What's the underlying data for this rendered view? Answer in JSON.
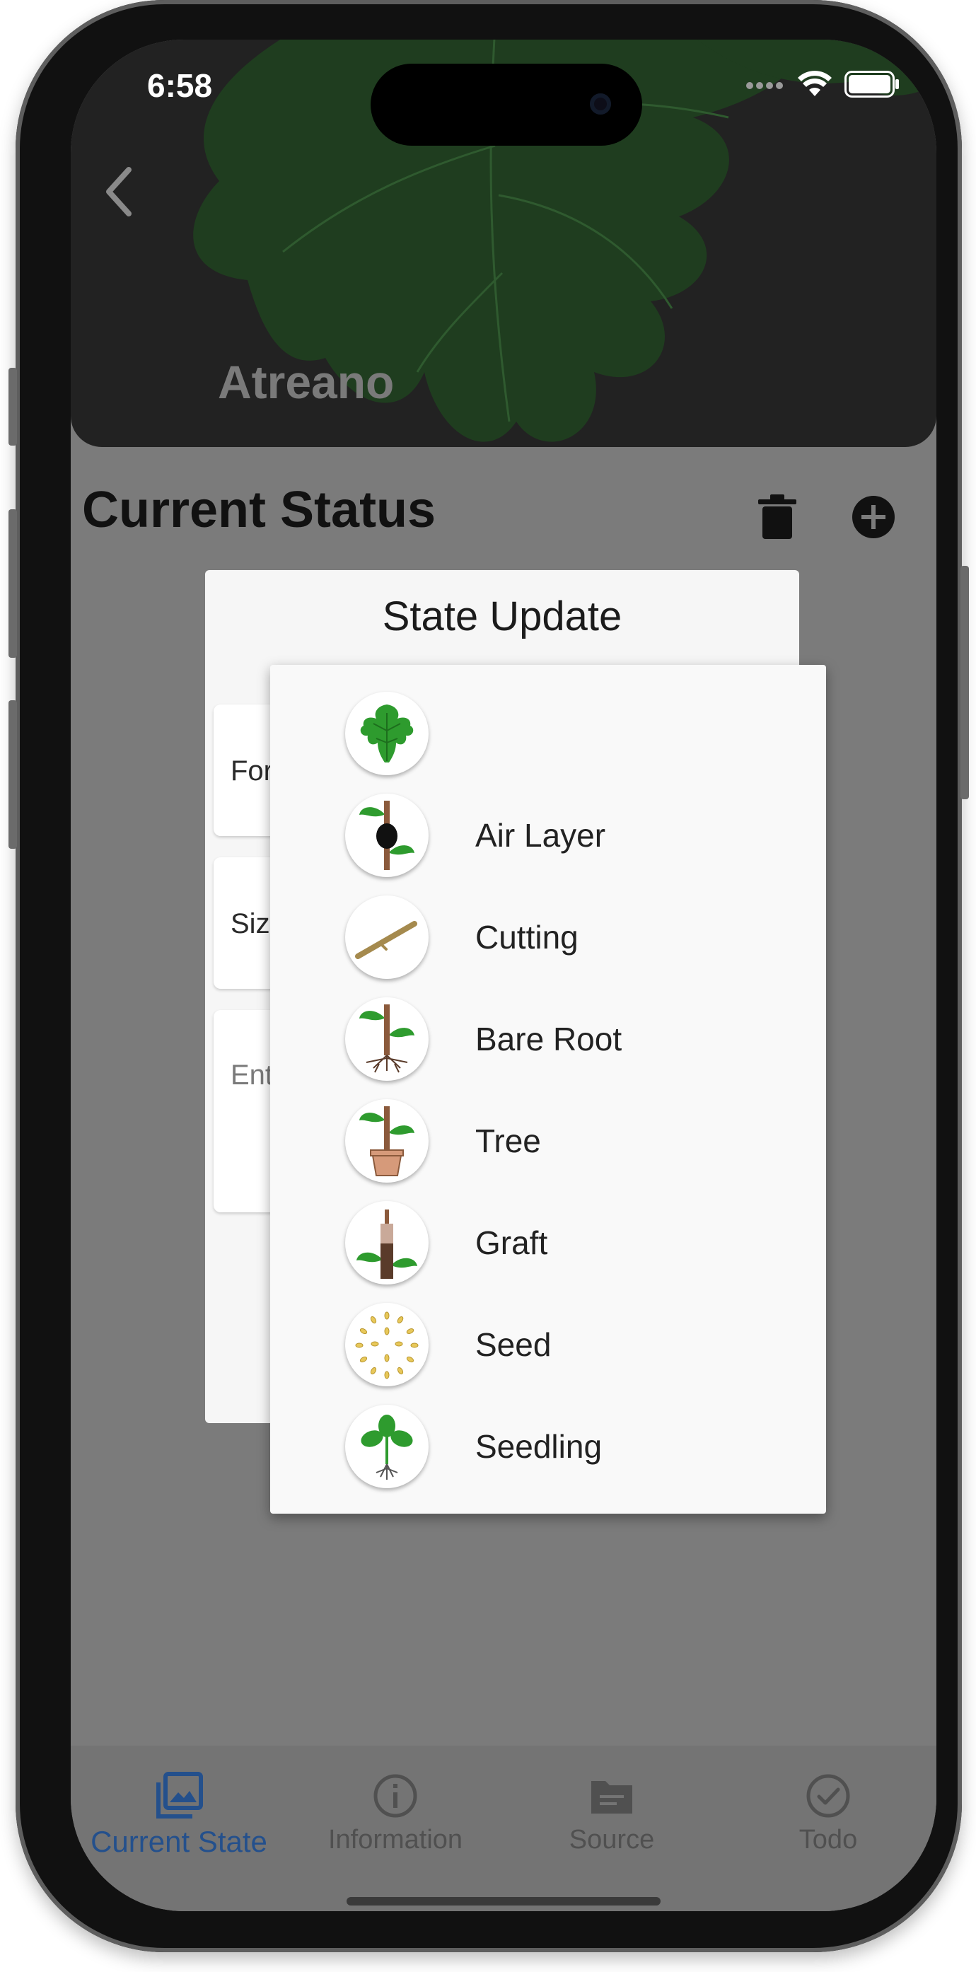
{
  "status_bar": {
    "time": "6:58"
  },
  "header": {
    "plant_name": "Atreano"
  },
  "page": {
    "section_title": "Current Status"
  },
  "dialog": {
    "title": "State Update",
    "fields": [
      {
        "text": "For"
      },
      {
        "text": "Siz"
      },
      {
        "placeholder": "Ent"
      }
    ]
  },
  "menu": {
    "items": [
      {
        "label": "",
        "icon": "fig-leaf-icon"
      },
      {
        "label": "Air Layer",
        "icon": "air-layer-icon"
      },
      {
        "label": "Cutting",
        "icon": "cutting-icon"
      },
      {
        "label": "Bare Root",
        "icon": "bare-root-icon"
      },
      {
        "label": "Tree",
        "icon": "potted-tree-icon"
      },
      {
        "label": "Graft",
        "icon": "graft-icon"
      },
      {
        "label": "Seed",
        "icon": "seeds-icon"
      },
      {
        "label": "Seedling",
        "icon": "seedling-icon"
      }
    ]
  },
  "tabs": [
    {
      "label": "Current State",
      "icon": "photo-library-icon",
      "active": true
    },
    {
      "label": "Information",
      "icon": "info-icon",
      "active": false
    },
    {
      "label": "Source",
      "icon": "folder-icon",
      "active": false
    },
    {
      "label": "Todo",
      "icon": "check-circle-icon",
      "active": false
    }
  ],
  "colors": {
    "overlay_gray": "#7b7b7b",
    "header_dark": "#222222",
    "leaf_green": "#1f3d1f",
    "active_tab": "#24508c",
    "icon_green": "#2e9b2e"
  }
}
